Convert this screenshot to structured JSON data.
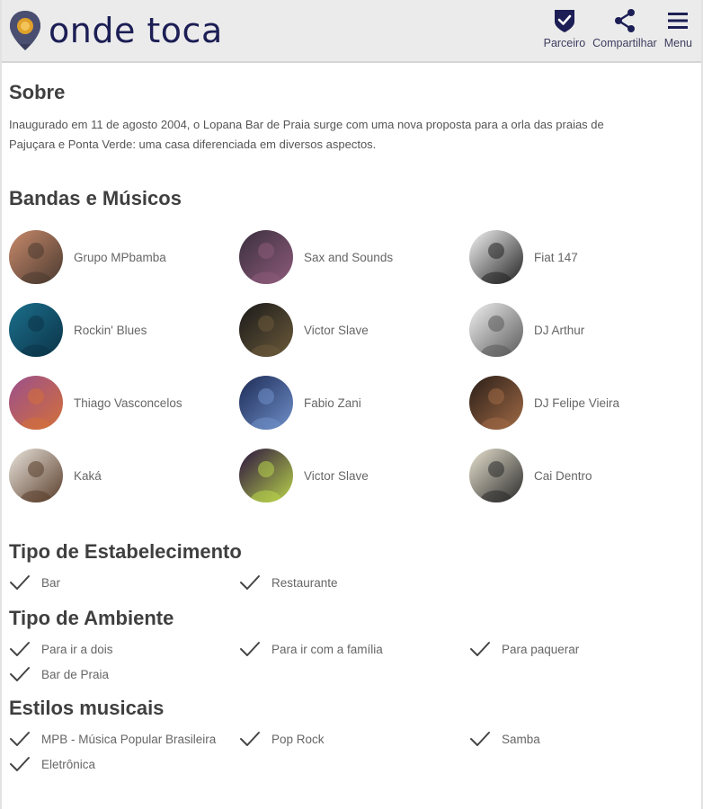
{
  "header": {
    "logo_text": "onde toca",
    "actions": [
      {
        "label": "Parceiro",
        "icon": "shield-check-icon"
      },
      {
        "label": "Compartilhar",
        "icon": "share-icon"
      },
      {
        "label": "Menu",
        "icon": "hamburger-icon"
      }
    ]
  },
  "about": {
    "title": "Sobre",
    "text_line1": "Inaugurado em 11 de agosto 2004, o Lopana Bar de Praia surge com uma nova proposta para a orla das praias de",
    "text_line2": "Pajuçara e Ponta Verde: uma casa diferenciada em diversos aspectos."
  },
  "bands": {
    "title": "Bandas e Músicos",
    "items": [
      {
        "name": "Grupo MPbamba",
        "colors": [
          "#c98a6b",
          "#4a3a30"
        ]
      },
      {
        "name": "Sax and Sounds",
        "colors": [
          "#3a2f3e",
          "#8d5b7a"
        ]
      },
      {
        "name": "Fiat 147",
        "colors": [
          "#f4f4f4",
          "#222222"
        ]
      },
      {
        "name": "Rockin' Blues",
        "colors": [
          "#1c6f8c",
          "#0b3448"
        ]
      },
      {
        "name": "Victor Slave",
        "colors": [
          "#1a1a1a",
          "#6b5a3a"
        ]
      },
      {
        "name": "DJ Arthur",
        "colors": [
          "#f0f0f0",
          "#5a5a5a"
        ]
      },
      {
        "name": "Thiago Vasconcelos",
        "colors": [
          "#9b4f8c",
          "#d3703a"
        ]
      },
      {
        "name": "Fabio Zani",
        "colors": [
          "#1d2b56",
          "#6f8fc9"
        ]
      },
      {
        "name": "DJ Felipe Vieira",
        "colors": [
          "#2a1e18",
          "#a06a45"
        ]
      },
      {
        "name": "Kaká",
        "colors": [
          "#e9e4dc",
          "#5a3e2b"
        ]
      },
      {
        "name": "Victor Slave",
        "colors": [
          "#2b1240",
          "#b8d34a"
        ]
      },
      {
        "name": "Cai Dentro",
        "colors": [
          "#e8e2cf",
          "#2a2a2a"
        ]
      }
    ]
  },
  "tipo_estabelecimento": {
    "title": "Tipo de Estabelecimento",
    "items": [
      "Bar",
      "Restaurante"
    ]
  },
  "tipo_ambiente": {
    "title": "Tipo de Ambiente",
    "items": [
      "Para ir a dois",
      "Para ir com a família",
      "Para paquerar",
      "Bar de Praia"
    ]
  },
  "estilos": {
    "title": "Estilos musicais",
    "items": [
      "MPB - Música Popular Brasileira",
      "Pop Rock",
      "Samba",
      "Eletrônica"
    ]
  },
  "colors": {
    "brand": "#1c1e55",
    "header_bg": "#ebebeb",
    "pin_top": "#2c2f4e",
    "pin_accent": "#e0a12a"
  }
}
